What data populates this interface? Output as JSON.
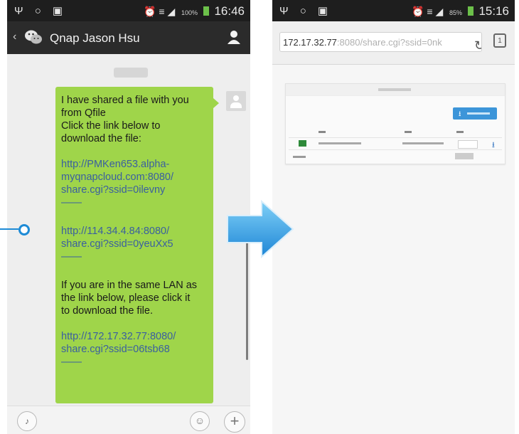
{
  "left_phone": {
    "status": {
      "left_icons": "Ψ ○ ▣",
      "right_icons": "⏰ ≡ ◢",
      "battery": "100%",
      "time": "16:46"
    },
    "header": {
      "back": "‹",
      "contact": "Qnap Jason Hsu"
    },
    "message": {
      "intro": [
        "I have shared a file with you",
        "from Qfile",
        "Click the link below to",
        "download the file:"
      ],
      "link1": [
        "http://PMKen653.alpha-",
        "myqnapcloud.com:8080/",
        "share.cgi?ssid=0ilevny"
      ],
      "link2": [
        "http://114.34.4.84:8080/",
        "share.cgi?ssid=0yeuXx5"
      ],
      "lan_note": [
        "If you are in the same LAN as",
        "the link below, please click it",
        "to download the file."
      ],
      "link3": [
        "http://172.17.32.77:8080/",
        "share.cgi?ssid=06tsb68"
      ],
      "separator": "——"
    },
    "input_bar": {
      "voice": "♪",
      "emoji": "☺",
      "plus": "+"
    }
  },
  "right_phone": {
    "status": {
      "left_icons": "Ψ ○ ▣",
      "right_icons": "⏰ ≡ ◢",
      "battery": "85%",
      "time": "15:16"
    },
    "url": {
      "host": "172.17.32.77",
      "path": ":8080/share.cgi?ssid=0nk"
    },
    "refresh": "↻",
    "tabs": "1",
    "download_glyph": "⭳",
    "row_download_glyph": "⭳"
  },
  "colors": {
    "bubble": "#9fd54a",
    "link": "#3a5fa0",
    "callout": "#1e8bd6",
    "arrow": "#3aa0e4"
  }
}
